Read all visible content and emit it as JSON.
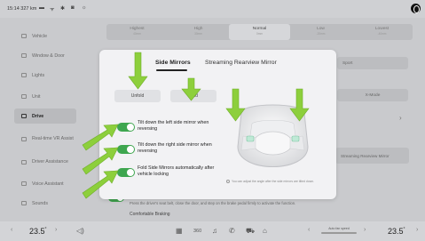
{
  "status_bar": {
    "time": "15:14",
    "range": "327 km",
    "icons": [
      "battery-icon",
      "signal-icon",
      "bluetooth-icon",
      "camera-icon",
      "sun-icon"
    ]
  },
  "sidebar": {
    "items": [
      {
        "label": "Vehicle",
        "icon": "car-icon",
        "active": false
      },
      {
        "label": "Window & Door",
        "icon": "window-icon",
        "active": false
      },
      {
        "label": "Lights",
        "icon": "light-icon",
        "active": false
      },
      {
        "label": "Unit",
        "icon": "ruler-icon",
        "active": false
      },
      {
        "label": "Drive",
        "icon": "steering-icon",
        "active": true
      },
      {
        "label": "Real-time VR Assist",
        "icon": "vr-icon",
        "active": false
      },
      {
        "label": "Driver Assistance",
        "icon": "assist-icon",
        "active": false
      },
      {
        "label": "Voice Assistant",
        "icon": "mic-icon",
        "active": false
      },
      {
        "label": "Sounds",
        "icon": "speaker-icon",
        "active": false
      }
    ]
  },
  "background": {
    "segment_options": [
      {
        "label": "Highest",
        "sub": "40mm"
      },
      {
        "label": "High",
        "sub": "30mm"
      },
      {
        "label": "Normal",
        "sub": "0mm",
        "selected": true
      },
      {
        "label": "Low",
        "sub": "-20mm"
      },
      {
        "label": "Lowest",
        "sub": "-40mm"
      }
    ],
    "sport_label": "Sport",
    "xmode_label": "X-Mode",
    "streaming_label": "Streaming Rearview Mirror",
    "hint_text": "Press the driver's seat belt, close the door, and step on the brake pedal firmly to activate the function.",
    "comfortable_braking": "Comfortable Braking"
  },
  "modal": {
    "tabs": [
      {
        "label": "Side Mirrors",
        "active": true
      },
      {
        "label": "Streaming Rearview Mirror",
        "active": false
      }
    ],
    "buttons": {
      "unfold": "Unfold",
      "fold": "Fold"
    },
    "options": [
      {
        "label": "Tilt down the left side mirror when reversing",
        "enabled": true
      },
      {
        "label": "Tilt down the right side mirror when reversing",
        "enabled": true
      },
      {
        "label": "Fold Side Mirrors automatically after vehicle locking",
        "enabled": true
      }
    ],
    "note": "You can adjust the angle after the side mirrors are tilted down."
  },
  "dock": {
    "left_temp": "23.5",
    "right_temp": "23.5",
    "temp_unit": "°",
    "fan_label": "Auto fan speed",
    "icons": [
      "volume-icon",
      "grid-icon",
      "360-view-icon",
      "music-icon",
      "phone-icon",
      "car-icon",
      "home-icon"
    ]
  },
  "colors": {
    "toggle_on": "#3ea64f",
    "annotation_arrow": "#8dcf3c",
    "active_sidebar": "#b9babd"
  }
}
